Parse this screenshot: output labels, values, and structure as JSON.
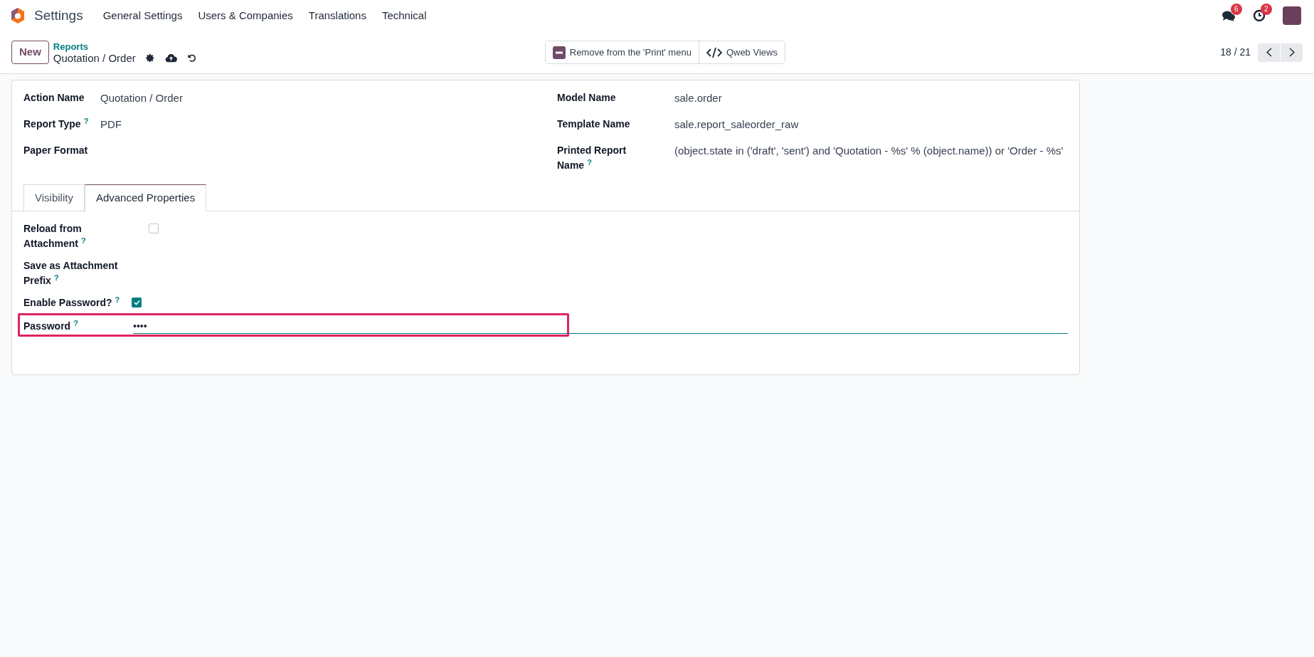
{
  "navbar": {
    "app_name": "Settings",
    "menu": [
      "General Settings",
      "Users & Companies",
      "Translations",
      "Technical"
    ],
    "messages_badge": "6",
    "activities_badge": "2"
  },
  "control_panel": {
    "new_button": "New",
    "breadcrumb_parent": "Reports",
    "breadcrumb_current": "Quotation / Order",
    "actions": [
      {
        "kind": "remove",
        "label": "Remove from the 'Print' menu"
      },
      {
        "kind": "code",
        "label": "Qweb Views"
      }
    ],
    "pager": "18 / 21"
  },
  "form": {
    "left_fields": [
      {
        "label": "Action Name",
        "value": "Quotation / Order"
      },
      {
        "label": "Report Type",
        "help": "?",
        "value": "PDF"
      },
      {
        "label": "Paper Format"
      }
    ],
    "right_fields": [
      {
        "label": "Model Name",
        "value": "sale.order"
      },
      {
        "label": "Template Name",
        "value": "sale.report_saleorder_raw"
      },
      {
        "label": "Printed Report Name",
        "help": "?",
        "value": "(object.state in ('draft', 'sent') and 'Quotation - %s' % (object.name)) or 'Order - %s'"
      }
    ],
    "tabs": [
      {
        "label": "Visibility",
        "selected": false
      },
      {
        "label": "Advanced Properties",
        "selected": true
      }
    ],
    "tab_fields": [
      {
        "kind": "checkbox",
        "label": "Reload from Attachment",
        "help": "?",
        "checked": false
      },
      {
        "kind": "empty",
        "label": "Save as Attachment Prefix",
        "help": "?"
      },
      {
        "kind": "checkbox",
        "label": "Enable Password?",
        "help": "?",
        "checked": true
      },
      {
        "kind": "password",
        "label": "Password",
        "help": "?",
        "value": "••••",
        "highlighted": true
      }
    ]
  }
}
